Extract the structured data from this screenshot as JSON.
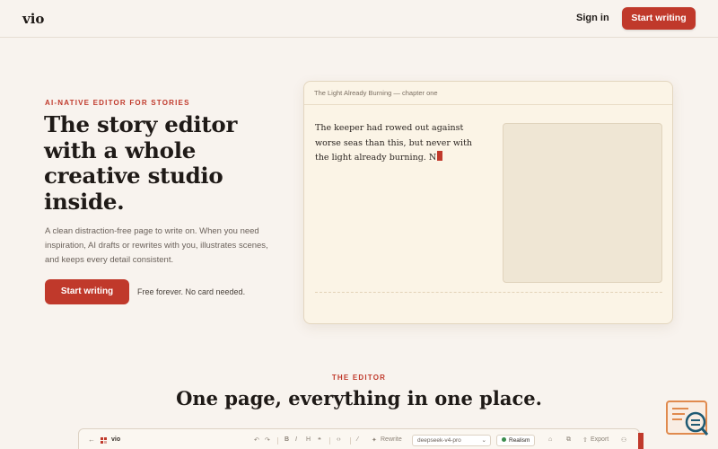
{
  "header": {
    "logo": "vio",
    "signin_label": "Sign in",
    "cta_label": "Start writing"
  },
  "hero": {
    "eyebrow": "AI-NATIVE EDITOR FOR STORIES",
    "title": "The story editor with a whole creative studio inside.",
    "description": "A clean distraction-free page to write on. When you need inspiration, AI drafts or rewrites with you, illustrates scenes, and keeps every detail consistent.",
    "cta_label": "Start writing",
    "note": "Free forever. No card needed."
  },
  "editor_card": {
    "title": "The Light Already Burning — chapter one",
    "text": "The keeper had rowed out against worse seas than this, but never with the light already burning. N"
  },
  "section": {
    "eyebrow": "THE EDITOR",
    "title": "One page, everything in one place."
  },
  "preview": {
    "back_icon": "←",
    "app_name": "vio",
    "tool_rewrite": "Rewrite",
    "model": "deepseek-v4-pro",
    "mode": "Realism",
    "export_label": "Export"
  },
  "colors": {
    "accent": "#c0392b",
    "background": "#f8f3ee",
    "card": "#fbf4e6"
  },
  "icons": {
    "help": "help-chat-icon",
    "menu_grid": "grid-icon"
  }
}
